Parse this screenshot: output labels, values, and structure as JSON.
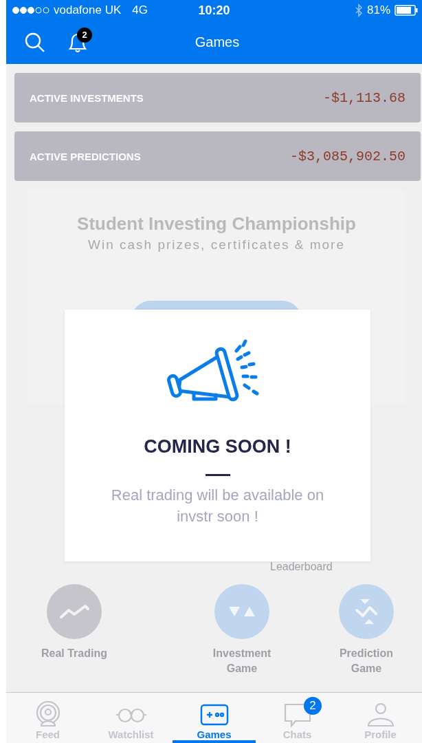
{
  "status_bar": {
    "carrier": "vodafone UK",
    "network": "4G",
    "time": "10:20",
    "battery": "81%"
  },
  "nav": {
    "title": "Games",
    "notification_count": "2"
  },
  "summary": [
    {
      "label": "ACTIVE INVESTMENTS",
      "value": "-$1,113.68"
    },
    {
      "label": "ACTIVE PREDICTIONS",
      "value": "-$3,085,902.50"
    }
  ],
  "promo": {
    "title": "Student Investing Championship",
    "subtitle": "Win cash prizes, certificates & more"
  },
  "leaderboard_label": "Leaderboard",
  "games": [
    {
      "label": "Real Trading",
      "kind": "trading"
    },
    {
      "label": "Investment Game",
      "kind": "investment"
    },
    {
      "label": "Prediction Game",
      "kind": "prediction"
    }
  ],
  "modal": {
    "title": "COMING SOON !",
    "message": "Real trading will be available on invstr soon !"
  },
  "tab_bar": [
    {
      "label": "Feed",
      "kind": "feed",
      "selected": false
    },
    {
      "label": "Watchlist",
      "kind": "watchlist",
      "selected": false
    },
    {
      "label": "Games",
      "kind": "games",
      "selected": true
    },
    {
      "label": "Chats",
      "kind": "chats",
      "selected": false,
      "badge": "2"
    },
    {
      "label": "Profile",
      "kind": "profile",
      "selected": false
    }
  ]
}
